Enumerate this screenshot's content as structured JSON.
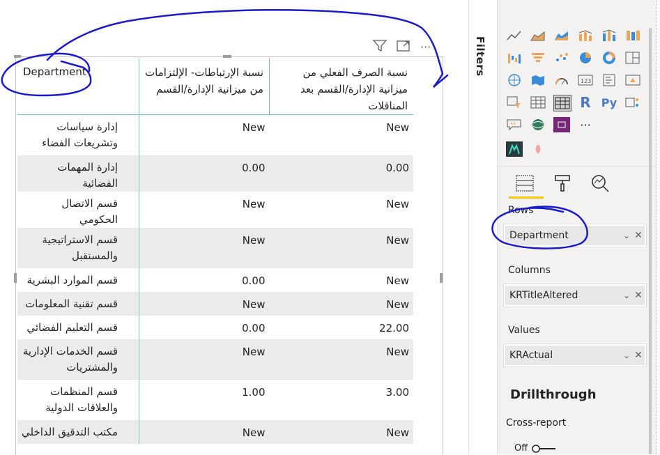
{
  "filters_pane": {
    "label": "Filters"
  },
  "matrix": {
    "row_header": "Department",
    "column_headers": [
      "نسبة الإرتباطات- الإلتزامات من ميزانية الإدارة/القسم",
      "نسبة الصرف الفعلي من ميزانية الإدارة/القسم بعد المناقلات"
    ],
    "rows": [
      {
        "department": "إدارة سياسات وتشريعات الفضاء",
        "values": [
          "New",
          "New"
        ]
      },
      {
        "department": "إدارة المهمات الفضائية",
        "values": [
          "0.00",
          "0.00"
        ]
      },
      {
        "department": "قسم الاتصال الحكومي",
        "values": [
          "New",
          "New"
        ]
      },
      {
        "department": "قسم الاستراتيجية والمستقبل",
        "values": [
          "New",
          "New"
        ]
      },
      {
        "department": "قسم الموارد البشرية",
        "values": [
          "0.00",
          "New"
        ]
      },
      {
        "department": "قسم تقنية المعلومات",
        "values": [
          "New",
          "New"
        ]
      },
      {
        "department": "قسم التعليم الفضائي",
        "values": [
          "0.00",
          "22.00"
        ]
      },
      {
        "department": "قسم الخدمات الإدارية والمشتريات",
        "values": [
          "New",
          "New"
        ]
      },
      {
        "department": "قسم المنظمات والعلاقات الدولية",
        "values": [
          "1.00",
          "3.00"
        ]
      },
      {
        "department": "مكتب التدقيق الداخلي",
        "values": [
          "New",
          "New"
        ]
      }
    ]
  },
  "visual_toolbar": {
    "icons": [
      "filter-icon",
      "focus-mode-icon",
      "more-options-icon"
    ],
    "more_glyph": "···"
  },
  "viz_gallery": {
    "more_glyph": "···",
    "r_label": "R",
    "py_label": "Py"
  },
  "wells": {
    "rows": {
      "title": "Rows",
      "field": "Department"
    },
    "columns": {
      "title": "Columns",
      "field": "KRTitleAltered"
    },
    "values": {
      "title": "Values",
      "field": "KRActual"
    }
  },
  "drillthrough": {
    "title": "Drillthrough",
    "cross_report_label": "Cross-report",
    "toggle_state": "Off"
  },
  "colors": {
    "accent": "#f2c811",
    "grid_line": "#6ec4c4",
    "annotation": "#1a1acc",
    "row_shade": "#ebebeb"
  }
}
